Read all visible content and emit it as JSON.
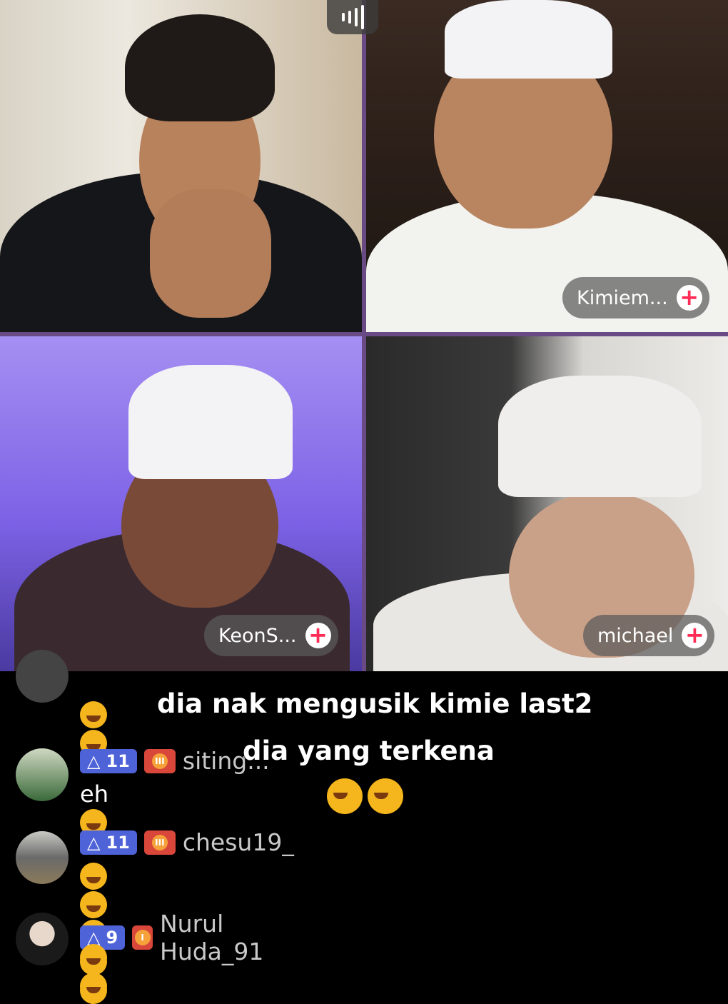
{
  "participants": [
    {
      "name": ""
    },
    {
      "name": "Kimiem..."
    },
    {
      "name": "KeonS..."
    },
    {
      "name": "michael"
    }
  ],
  "follow_icon": "+",
  "comments": [
    {
      "level": "",
      "username": "",
      "message": ""
    },
    {
      "level": "11",
      "username": "siting...",
      "message": "eh"
    },
    {
      "level": "11",
      "username": "chesu19_",
      "message": ""
    },
    {
      "level": "9",
      "username": "Nurul Huda_91",
      "message": ""
    }
  ],
  "caption": {
    "line1": "dia nak mengusik kimie last2",
    "line2": "dia yang terkena"
  },
  "colors": {
    "accent": "#ff2c55",
    "level_badge": "#4f63d8",
    "fan_badge": "#d8473a"
  },
  "icons": [
    "signal-icon",
    "plus-icon",
    "level-icon",
    "fan-heart-icon",
    "laughing-emoji-icon"
  ]
}
